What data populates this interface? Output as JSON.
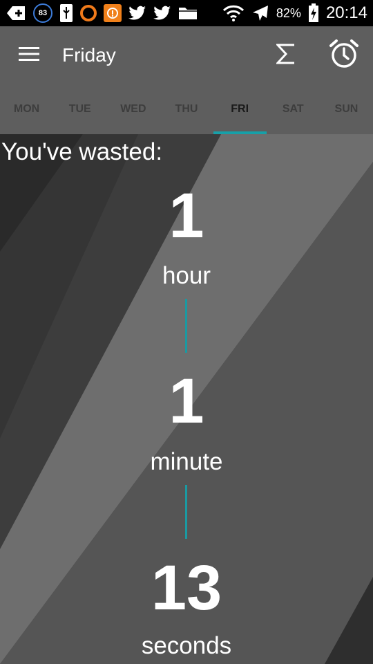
{
  "status_bar": {
    "notification_badge": "83",
    "battery_percent": "82%",
    "time": "20:14",
    "accent_badge_color": "#3c7bd8",
    "orange_app_color": "#f07a1a"
  },
  "toolbar": {
    "title": "Friday",
    "actions": [
      "summary-sigma-icon",
      "alarm-clock-icon"
    ]
  },
  "tabs": [
    {
      "label": "MON",
      "active": false
    },
    {
      "label": "TUE",
      "active": false
    },
    {
      "label": "WED",
      "active": false
    },
    {
      "label": "THU",
      "active": false
    },
    {
      "label": "FRI",
      "active": true
    },
    {
      "label": "SAT",
      "active": false
    },
    {
      "label": "SUN",
      "active": false
    }
  ],
  "main": {
    "heading": "You've wasted:",
    "hours_value": "1",
    "hours_unit": "hour",
    "minutes_value": "1",
    "minutes_unit": "minute",
    "seconds_value": "13",
    "seconds_unit": "seconds",
    "accent_color": "#17a0a8"
  }
}
